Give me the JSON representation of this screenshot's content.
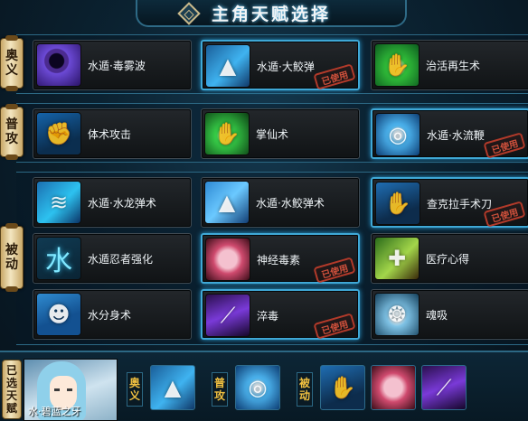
{
  "title": "主角天赋选择",
  "categories": {
    "ougi": [
      "奥",
      "义"
    ],
    "basic": [
      "普",
      "攻"
    ],
    "passive": [
      "被",
      "动"
    ]
  },
  "stamp_text": "已使用",
  "skills": {
    "ougi": [
      {
        "name": "水遁·毒雾波",
        "icon": "purple-mist-icon",
        "used": false
      },
      {
        "name": "水遁·大鲛弹",
        "icon": "shark-icon",
        "used": true
      },
      {
        "name": "治活再生术",
        "icon": "green-healing-hand-icon",
        "used": false
      }
    ],
    "basic": [
      {
        "name": "体术攻击",
        "icon": "fist-icon",
        "used": false
      },
      {
        "name": "掌仙术",
        "icon": "green-palm-icon",
        "used": false
      },
      {
        "name": "水遁·水流鞭",
        "icon": "water-whip-icon",
        "used": true
      }
    ],
    "passive": [
      {
        "name": "水遁·水龙弹术",
        "icon": "water-dragon-icon",
        "used": false
      },
      {
        "name": "水遁·水鲛弹术",
        "icon": "water-shark-icon",
        "used": false
      },
      {
        "name": "查克拉手术刀",
        "icon": "chakra-scalpel-glove-icon",
        "used": true
      },
      {
        "name": "水遁忍者强化",
        "icon": "water-kanji-icon",
        "kanji": "水",
        "used": false
      },
      {
        "name": "神经毒素",
        "icon": "brain-icon",
        "used": true
      },
      {
        "name": "医疗心得",
        "icon": "syringe-icon",
        "used": false
      },
      {
        "name": "水分身术",
        "icon": "water-clone-icon",
        "used": false
      },
      {
        "name": "淬毒",
        "icon": "poison-blade-icon",
        "used": true
      },
      {
        "name": "魂吸",
        "icon": "soul-drain-icon",
        "used": false
      }
    ]
  },
  "selected": {
    "label": [
      "已",
      "选",
      "天",
      "赋"
    ],
    "character_name": "水·碧蓝之牙",
    "ougi_tag": [
      "奥",
      "义"
    ],
    "basic_tag": [
      "普",
      "攻"
    ],
    "passive_tag": [
      "被",
      "动"
    ],
    "slots": [
      {
        "group": "ougi",
        "icon": "shark-icon"
      },
      {
        "group": "basic",
        "icon": "water-whip-icon"
      },
      {
        "group": "passive",
        "icon": "chakra-scalpel-glove-icon"
      },
      {
        "group": "passive",
        "icon": "brain-icon"
      },
      {
        "group": "passive",
        "icon": "poison-blade-icon"
      }
    ]
  }
}
